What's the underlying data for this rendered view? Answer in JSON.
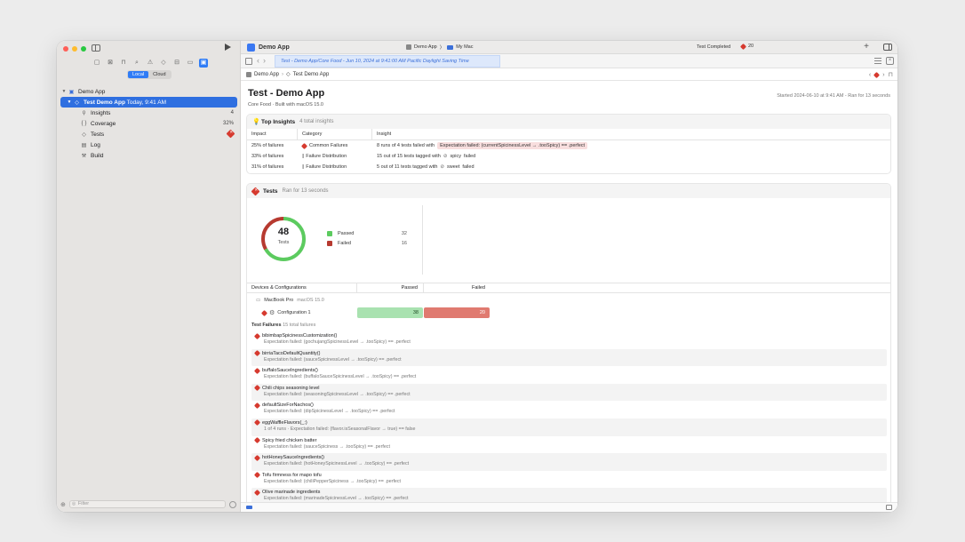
{
  "window": {
    "app_title": "Demo App",
    "scheme": "Demo App",
    "scheme_sep": "〉",
    "destination": "My Mac",
    "status": "Test Completed",
    "fail_count": "20",
    "add_label": "+"
  },
  "sidebar": {
    "nav_icons": [
      "▢",
      "⊠",
      "⊓",
      "⌕",
      "⚠",
      "◇",
      "⊟",
      "▭",
      "▣"
    ],
    "segment": {
      "local": "Local",
      "cloud": "Cloud"
    },
    "tree": {
      "project": "Demo App",
      "run_title": "Test Demo App",
      "run_time": "Today, 9:41 AM",
      "items": [
        {
          "icon": "💡",
          "label": "Insights",
          "value": "4"
        },
        {
          "icon": "{ }",
          "label": "Coverage",
          "value": "32%"
        },
        {
          "icon": "◇",
          "label": "Tests",
          "value": ""
        },
        {
          "icon": "▤",
          "label": "Log",
          "value": ""
        },
        {
          "icon": "⚒",
          "label": "Build",
          "value": ""
        }
      ]
    },
    "filter_placeholder": "Filter"
  },
  "tabbar": {
    "active_tab": "Test - Demo App/Core Food - Jun 10, 2024 at 9:41:00 AM Pacific Daylight Saving Time"
  },
  "jumpbar": {
    "crumb1": "Demo App",
    "crumb2": "Test Demo App"
  },
  "header": {
    "title": "Test - Demo App",
    "subtitle": "Core Food · Built with macOS 15.0",
    "meta": "Started 2024-06-10 at 9:41 AM - Ran for 13 seconds"
  },
  "insights": {
    "title": "Top Insights",
    "count": "4 total insights",
    "columns": [
      "Impact",
      "Category",
      "Insight"
    ],
    "rows": [
      {
        "impact": "25% of failures",
        "category": "Common Failures",
        "cat_icon": "fail",
        "text": "8 runs of 4 tests failed with",
        "chip": "Expectation failed: (currentSpicinessLevel → .tooSpicy) == .perfect"
      },
      {
        "impact": "33% of failures",
        "category": "Failure Distribution",
        "cat_icon": "bars",
        "text": "15 out of 15 tests tagged with",
        "tag": "spicy",
        "tail": "failed"
      },
      {
        "impact": "31% of failures",
        "category": "Failure Distribution",
        "cat_icon": "bars",
        "text": "5 out of 11 tests tagged with",
        "tag": "sweet",
        "tail": "failed"
      }
    ]
  },
  "tests": {
    "title": "Tests",
    "duration": "Ran for 13 seconds",
    "total": "48",
    "total_label": "Tests",
    "passed_label": "Passed",
    "passed": 32,
    "failed_label": "Failed",
    "failed": 16,
    "colors": {
      "passed": "#5ccb5f",
      "failed": "#b73a30",
      "passed_bar": "#a9e2b0",
      "failed_bar": "#e07a70"
    },
    "devices": {
      "columns": [
        "Devices & Configurations",
        "Passed",
        "Failed"
      ],
      "device": "MacBook Pro",
      "os": "macOS 15.0",
      "config": "Configuration 1",
      "config_passed": "38",
      "config_failed": "20"
    },
    "failures_title": "Test Failures",
    "failures_count": "15 total failures",
    "failures": [
      {
        "name": "bibimbapSpicinessCustomization()",
        "message": "Expectation failed: (gochujangSpicinessLevel → .tooSpicy) == .perfect"
      },
      {
        "name": "birriaTacoDefaultQuantity()",
        "message": "Expectation failed: (sauceSpicinessLevel → .tooSpicy) == .perfect"
      },
      {
        "name": "buffaloSauceIngredients()",
        "message": "Expectation failed: (buffaloSauceSpicinessLevel → .tooSpicy) == .perfect"
      },
      {
        "name": "Chili chips seasoning level",
        "message": "Expectation failed: (seasoningSpicinessLevel → .tooSpicy) == .perfect"
      },
      {
        "name": "defaultSizeForNachos()",
        "message": "Expectation failed: (dipSpicinessLevel → .tooSpicy) == .perfect"
      },
      {
        "name": "eggWaffleFlavors(_:)",
        "message": "1 of 4 runs · Expectation failed: (flavor.isSeasonalFlavor → true) == false"
      },
      {
        "name": "Spicy fried chicken batter",
        "message": "Expectation failed: (sauceSpiciness → .tooSpicy) == .perfect"
      },
      {
        "name": "hotHoneySauceIngredients()",
        "message": "Expectation failed: (hotHoneySpicinessLevel → .tooSpicy) == .perfect"
      },
      {
        "name": "Tofu firmness for mapo tofu",
        "message": "Expectation failed: (chiliPepperSpiciness → .tooSpicy) == .perfect"
      },
      {
        "name": "Olive marinade ingredients",
        "message": "Expectation failed: (marinadeSpicinessLevel → .tooSpicy) == .perfect"
      }
    ]
  }
}
